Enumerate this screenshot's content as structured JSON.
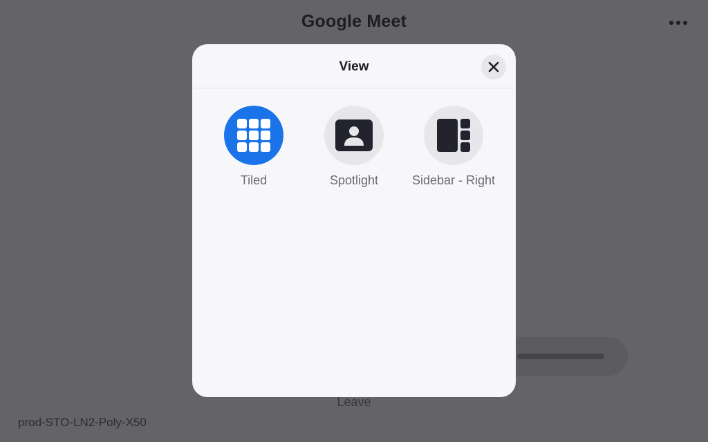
{
  "app": {
    "title": "Google Meet",
    "more_icon": "more-horizontal-icon",
    "leave_label": "Leave",
    "device_name": "prod-STO-LN2-Poly-X50"
  },
  "modal": {
    "title": "View",
    "close_icon": "close-icon",
    "options": [
      {
        "label": "Tiled",
        "icon": "grid-icon",
        "selected": true
      },
      {
        "label": "Spotlight",
        "icon": "spotlight-person-icon",
        "selected": false
      },
      {
        "label": "Sidebar - Right",
        "icon": "sidebar-right-icon",
        "selected": false
      }
    ]
  },
  "colors": {
    "accent": "#1a73e8",
    "overlay": "#646466",
    "modal_bg": "#f7f7fa",
    "icon_dark": "#23232d",
    "option_bg": "#e6e6eb"
  }
}
